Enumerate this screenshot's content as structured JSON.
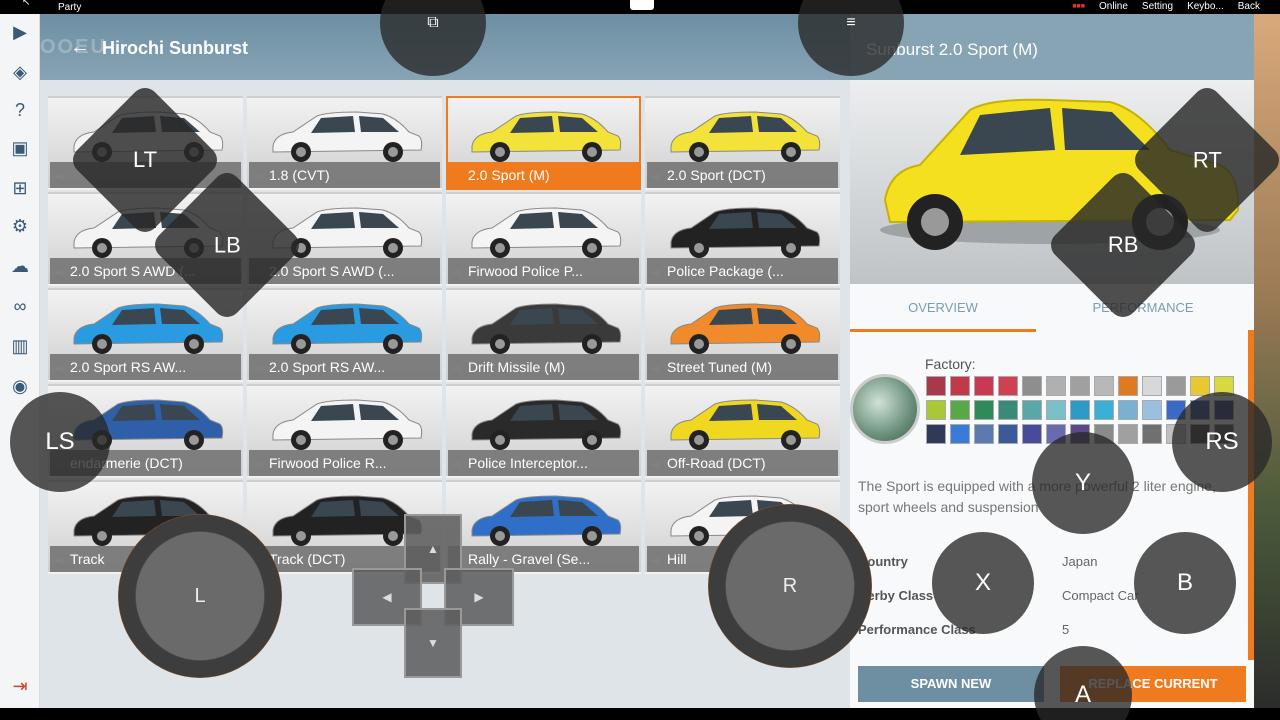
{
  "system_bar": {
    "party": "Party",
    "links": [
      {
        "name": "online",
        "label": "Online"
      },
      {
        "name": "setting",
        "label": "Setting"
      },
      {
        "name": "keyboard",
        "label": "Keybo..."
      },
      {
        "name": "back",
        "label": "Back"
      }
    ]
  },
  "header": {
    "ghost": "OOEU",
    "title": "Hirochi Sunburst"
  },
  "configs": [
    {
      "label": "",
      "color": "#f4f4f4"
    },
    {
      "label": "1.8 (CVT)",
      "color": "#f4f4f4"
    },
    {
      "label": "2.0 Sport (M)",
      "color": "#f2e23a",
      "selected": true
    },
    {
      "label": "2.0 Sport (DCT)",
      "color": "#f2e23a"
    },
    {
      "label": "2.0 Sport S AWD (...",
      "color": "#f4f4f4"
    },
    {
      "label": "2.0 Sport S AWD (...",
      "color": "#f4f4f4"
    },
    {
      "label": "Firwood Police P...",
      "color": "#f4f4f4"
    },
    {
      "label": "Police Package (...",
      "color": "#222222"
    },
    {
      "label": "2.0 Sport RS AW...",
      "color": "#2a9be0"
    },
    {
      "label": "2.0 Sport RS AW...",
      "color": "#2a9be0"
    },
    {
      "label": "Drift Missile (M)",
      "color": "#3a3a3a"
    },
    {
      "label": "Street Tuned (M)",
      "color": "#f08a2a"
    },
    {
      "label": "endarmerie (DCT)",
      "color": "#2e5fa8"
    },
    {
      "label": "Firwood Police R...",
      "color": "#f4f4f4"
    },
    {
      "label": "Police Interceptor...",
      "color": "#2a2a2a"
    },
    {
      "label": "Off-Road (DCT)",
      "color": "#f0d820"
    },
    {
      "label": "Track",
      "color": "#222222"
    },
    {
      "label": "Track (DCT)",
      "color": "#222222"
    },
    {
      "label": "Rally - Gravel (Se...",
      "color": "#2f6fc8"
    },
    {
      "label": "Hill",
      "color": "#f4f4f4"
    }
  ],
  "detail": {
    "title": "Sunburst 2.0 Sport (M)",
    "preview_color": "#f5e020",
    "tabs": [
      {
        "label": "OVERVIEW",
        "active": true
      },
      {
        "label": "PERFORMANCE"
      }
    ],
    "factory_label": "Factory:",
    "description": "The Sport is equipped with a more powerful 2 liter engine, sport wheels and suspension",
    "specs": [
      {
        "key": "Country",
        "value": "Japan"
      },
      {
        "key": "Derby Class",
        "value": "Compact Car"
      },
      {
        "key": "Performance Class",
        "value": "5"
      }
    ],
    "spawn_label": "SPAWN NEW",
    "replace_label": "REPLACE CURRENT",
    "swatches": [
      "#a8384a",
      "#c23a4a",
      "#c73a52",
      "#d04050",
      "#8e8e8e",
      "#b0b0b0",
      "#a0a0a0",
      "#b8b8b8",
      "#e07a20",
      "#d8d8d8",
      "#9a9a9a",
      "#e8c830",
      "#d8d840",
      "#a8c838",
      "#58a848",
      "#2e8a58",
      "#3a8a7a",
      "#58a8a8",
      "#7ac0c8",
      "#2e9ac8",
      "#3ab0d8",
      "#7ab0d0",
      "#9ac0e0",
      "#3a6ac8",
      "#2e4a90",
      "#2e3a78",
      "#2e3a58",
      "#3a7ad8",
      "#5a7ab0",
      "#3a5a9a",
      "#4a4a9a",
      "#6a6ab0",
      "#5a4a8a",
      "#8a8a8a",
      "#a0a0a0",
      "#707070",
      "#c0c0c0",
      "#404040",
      "#555555"
    ]
  },
  "overlays": {
    "lt": "LT",
    "lb": "LB",
    "rt": "RT",
    "rb": "RB",
    "ls": "LS",
    "rs": "RS",
    "l": "L",
    "r": "R",
    "a": "A",
    "b": "B",
    "x": "X",
    "y": "Y"
  }
}
